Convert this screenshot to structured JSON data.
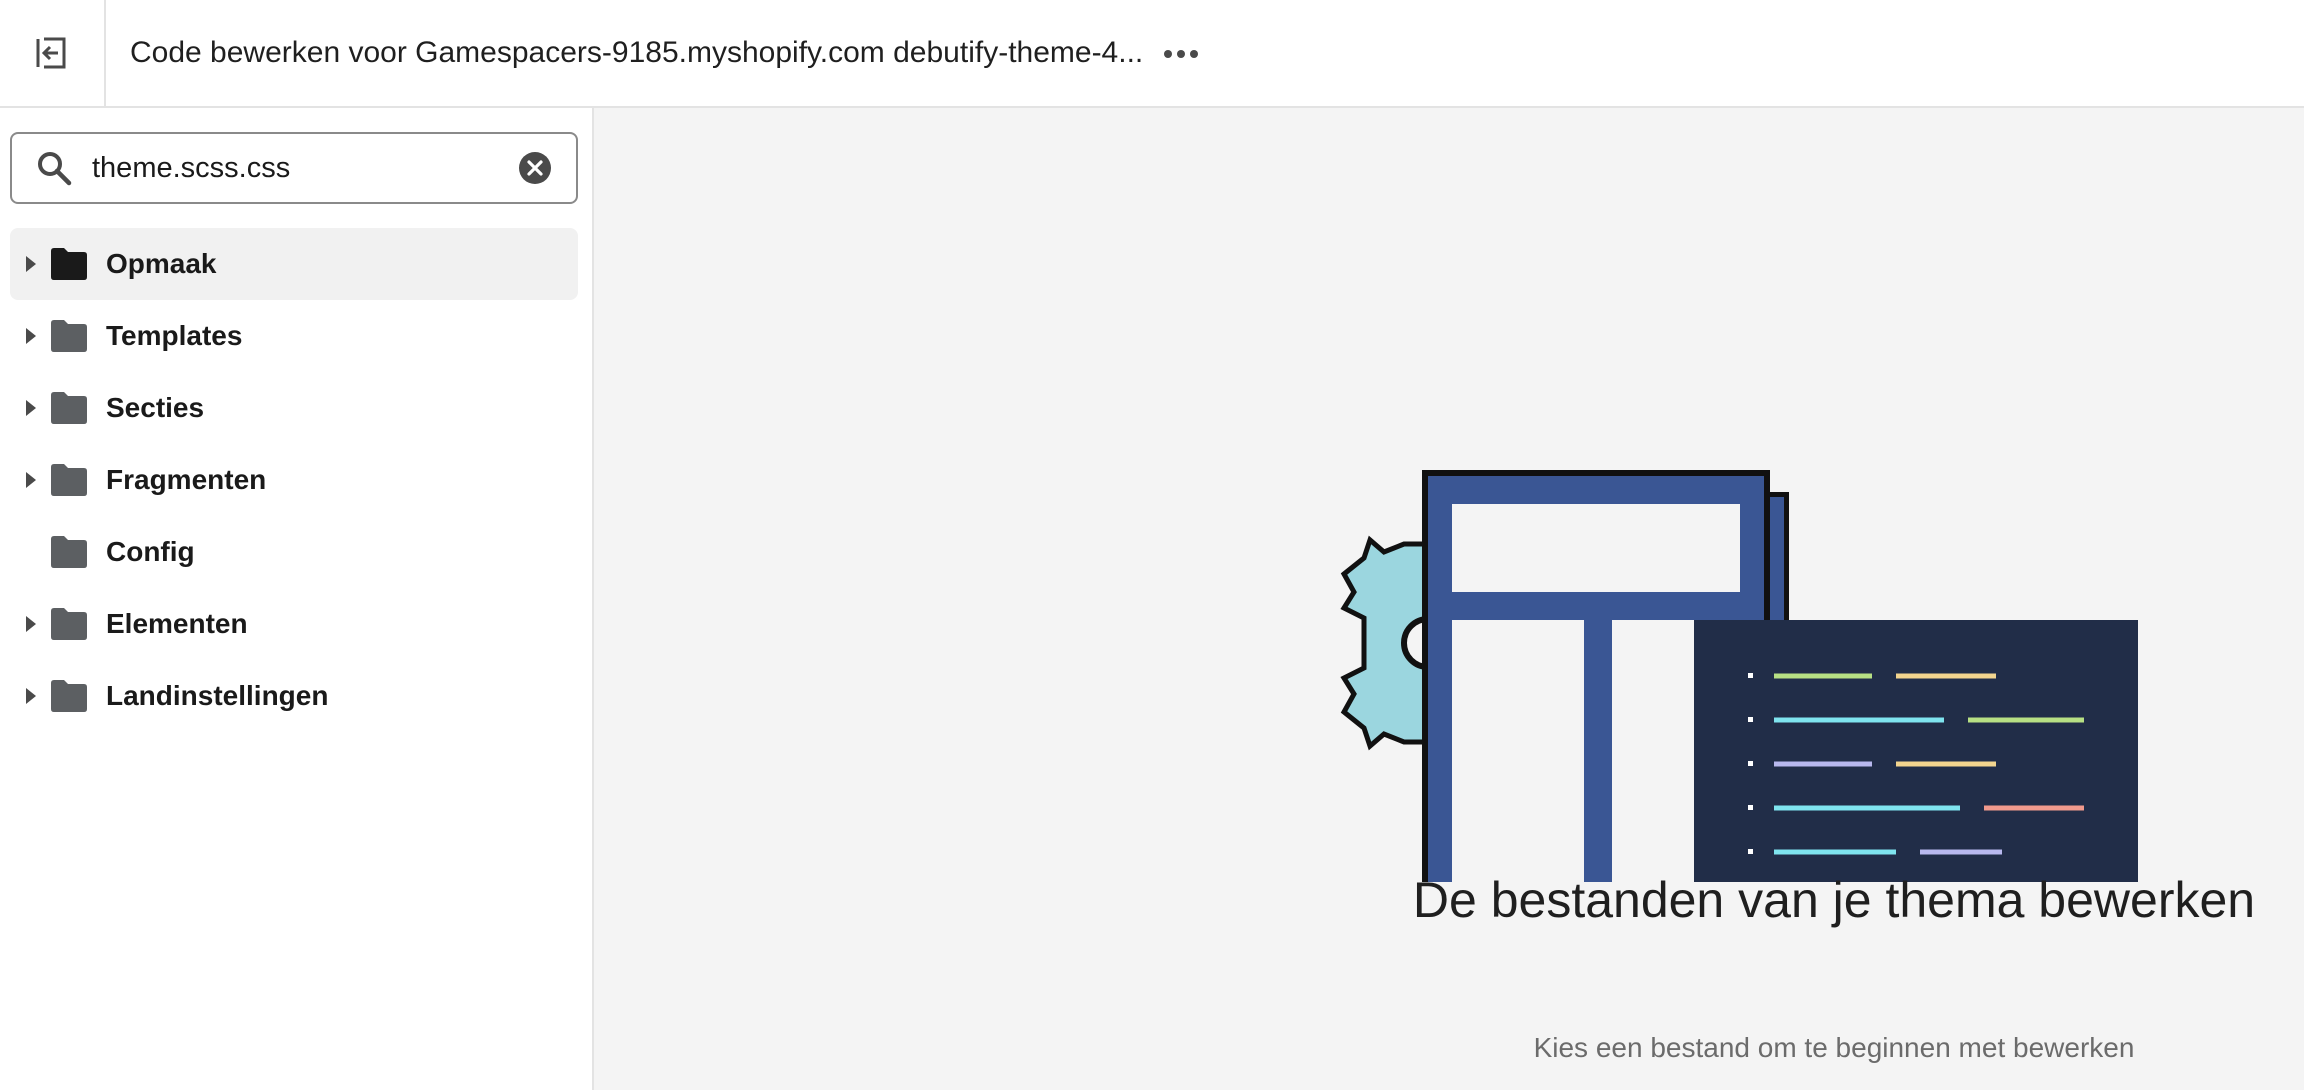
{
  "header": {
    "title": "Code bewerken voor Gamespacers-9185.myshopify.com debutify-theme-4...",
    "exit_icon": "exit-icon",
    "more_icon": "more-horizontal-icon"
  },
  "sidebar": {
    "search": {
      "value": "theme.scss.css",
      "icon": "search-icon",
      "clear_icon": "clear-circle-icon"
    },
    "items": [
      {
        "label": "Opmaak",
        "expandable": true,
        "selected": true
      },
      {
        "label": "Templates",
        "expandable": true,
        "selected": false
      },
      {
        "label": "Secties",
        "expandable": true,
        "selected": false
      },
      {
        "label": "Fragmenten",
        "expandable": true,
        "selected": false
      },
      {
        "label": "Config",
        "expandable": false,
        "selected": false
      },
      {
        "label": "Elementen",
        "expandable": true,
        "selected": false
      },
      {
        "label": "Landinstellingen",
        "expandable": true,
        "selected": false
      }
    ]
  },
  "main": {
    "empty_title": "De bestanden van je thema bewerken",
    "empty_subtitle": "Kies een bestand om te beginnen met bewerken"
  },
  "colors": {
    "panel_blue": "#3a5694",
    "code_bg": "#212d48",
    "gear": "#9bd6df",
    "folder_selected": "#1a1a1a",
    "folder": "#5c5f62"
  }
}
